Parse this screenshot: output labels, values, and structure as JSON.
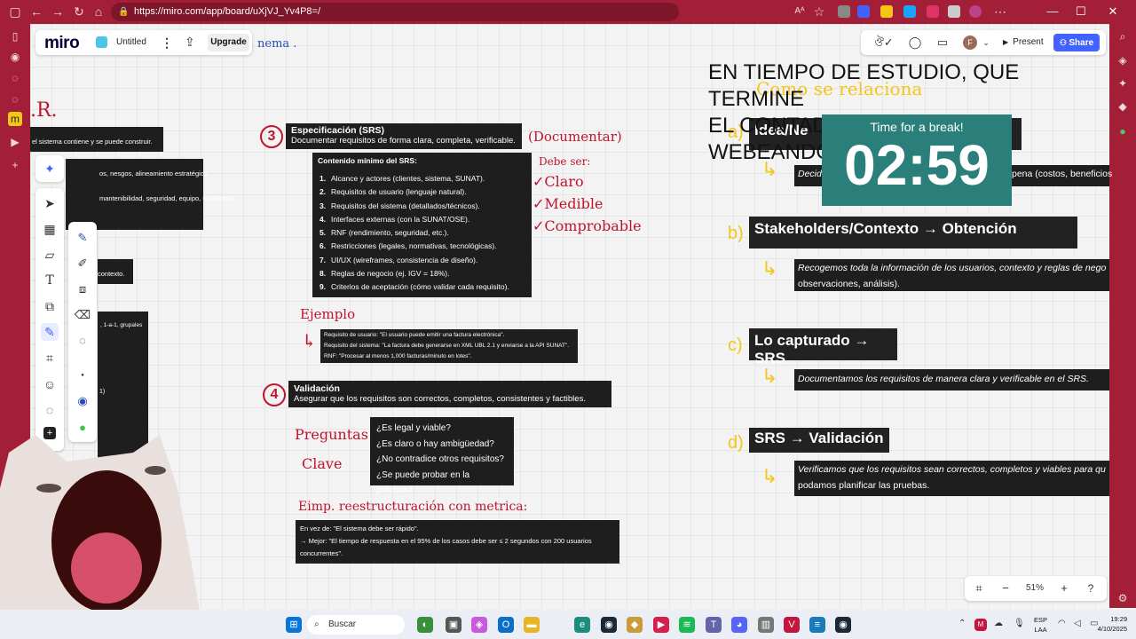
{
  "browser": {
    "url": "https://miro.com/app/board/uXjVJ_Yv4P8=/"
  },
  "miro": {
    "logo": "miro",
    "board_name": "Untitled",
    "upgrade": "Upgrade",
    "present": "Present",
    "share": "Share",
    "avatar_initial": "F",
    "zoom": "51%"
  },
  "overlay": {
    "line1": "EN TIEMPO DE ESTUDIO, QUE TERMINE",
    "line2": "EL CONTADOR PARA SEGUIR WEBEANDO"
  },
  "timer": {
    "title": "Time for a break!",
    "time": "02:59"
  },
  "left_partial": {
    "r_letter": ".R.",
    "l1": "el sistema contiene y se puede construir.",
    "l2": "os, nesgos, alineamiento estratégico.",
    "l3": "mantenibilidad, seguridad, equipo, usabilidad.",
    "l4": "contexto.",
    "l5": ", 1-a-1, grupales",
    "l6": "1)",
    "top_ink": "nema ."
  },
  "srs": {
    "number": "3",
    "title": "Especificación (SRS)",
    "subtitle": "Documentar requisitos de forma clara, completa, verificable.",
    "note": "(Documentar)",
    "debe": "Debe ser:",
    "c1": "✓Claro",
    "c2": "✓Medible",
    "c3": "✓Comprobable",
    "content_title": "Contenido mínimo del SRS:",
    "items": [
      "Alcance y actores (clientes, sistema, SUNAT).",
      "Requisitos de usuario (lenguaje natural).",
      "Requisitos del sistema (detallados/técnicos).",
      "Interfaces externas (con la SUNAT/OSE).",
      "RNF (rendimiento, seguridad, etc.).",
      "Restricciones (legales, normativas, tecnológicas).",
      "UI/UX (wireframes, consistencia de diseño).",
      "Reglas de negocio (ej. IGV = 18%).",
      "Criterios de aceptación (cómo validar cada requisito)."
    ]
  },
  "ejemplo": {
    "label": "Ejemplo",
    "l1": "Requisito de usuario: \"El usuario puede emitir una factura electrónica\".",
    "l2": "Requisito del sistema: \"La factura debe generarse en XML UBL 2.1 y enviarse a la API SUNAT\".",
    "l3": "RNF: \"Procesar al menos 1,000 facturas/minuto en lotes\"."
  },
  "validacion": {
    "number": "4",
    "title": "Validación",
    "subtitle": "Asegurar que los requisitos son correctos, completos, consistentes y factibles.",
    "preg1": "Preguntas",
    "preg2": "Clave",
    "questions": [
      "¿Es legal y viable?",
      "¿Es claro o hay ambigüedad?",
      "¿No contradice otros requisitos?",
      "¿Se puede probar en la práctica?"
    ],
    "metric_label": "Eimp. reestructuración con metrica:",
    "m1": "En vez de: \"El sistema debe ser rápido\".",
    "m2": "→ Mejor: \"El tiempo de respuesta en el 95% de los casos debe ser ≤ 2 segundos con 200 usuarios concurrentes\"."
  },
  "right": {
    "a_label": "a)",
    "a_title": "Idea/Ne",
    "a_desc_left": "Decidi",
    "a_desc_right": "pena (costos, beneficios",
    "b_label": "b)",
    "b_title": "Stakeholders/Contexto → Obtención",
    "b_desc1": "Recogemos toda la información de los usuarios, contexto y reglas de negocio (",
    "b_desc2": "observaciones, análisis).",
    "c_label": "c)",
    "c_title": "Lo capturado → SRS",
    "c_desc": "Documentamos los requisitos de manera clara y verificable en el SRS.",
    "d_label": "d)",
    "d_title": "SRS → Validación",
    "d_desc1": "Verificamos que los requisitos sean correctos, completos y viables para que todo",
    "d_desc2": "podamos planificar las pruebas.",
    "yellow_ink": "Como se relaciona"
  },
  "taskbar": {
    "search": "Buscar",
    "lang1": "ESP",
    "lang2": "LAA",
    "time": "19:29",
    "date": "4/10/2025"
  }
}
